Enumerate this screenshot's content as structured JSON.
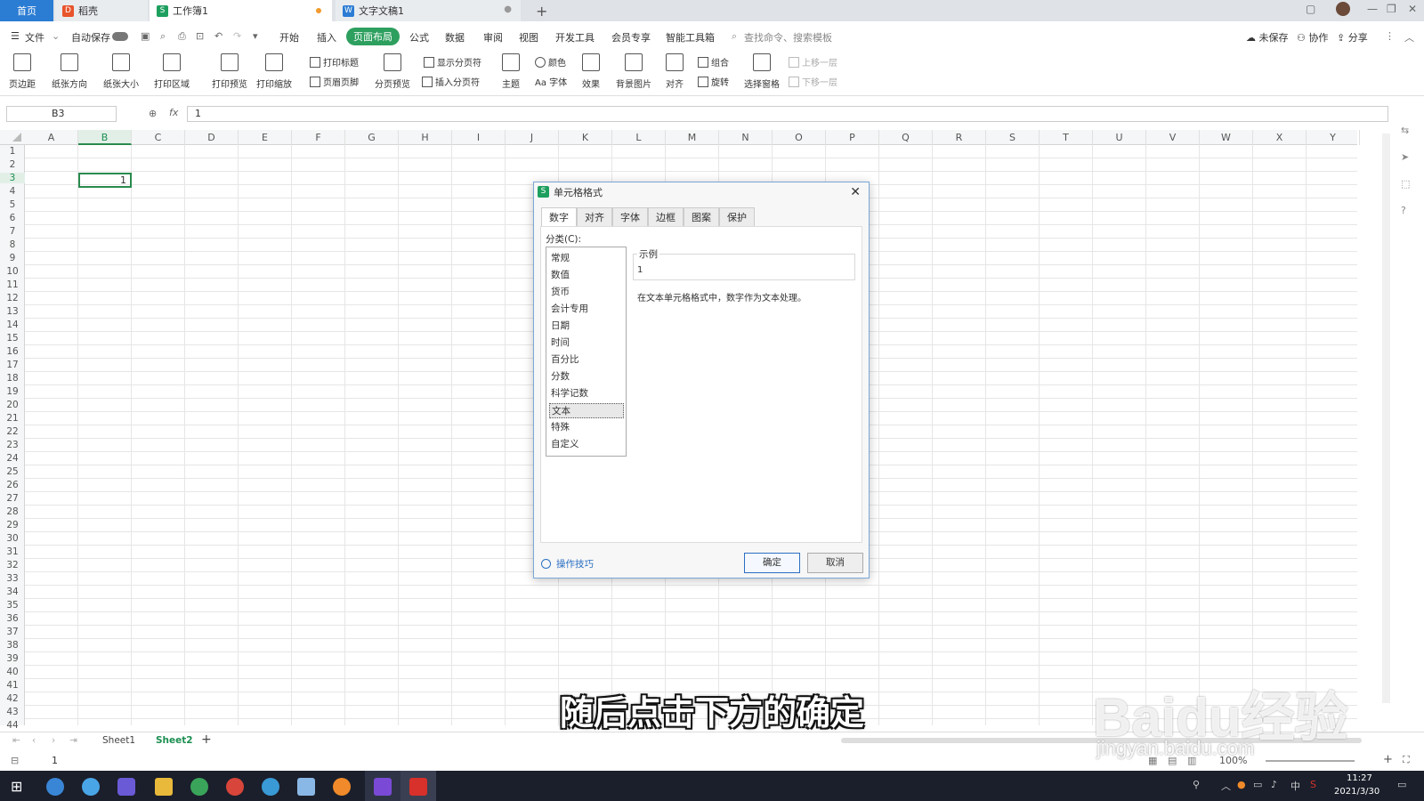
{
  "tabs": {
    "home": "首页",
    "daoke": "稻壳",
    "workbook": "工作簿1",
    "document": "文字文稿1",
    "new_tab": "+"
  },
  "menu": {
    "file": "文件",
    "autosave": "自动保存",
    "items": [
      "开始",
      "插入",
      "页面布局",
      "公式",
      "数据",
      "审阅",
      "视图",
      "开发工具",
      "会员专享",
      "智能工具箱"
    ],
    "active": "页面布局",
    "search_placeholder": "查找命令、搜索模板",
    "unsaved": "未保存",
    "collab": "协作",
    "share": "分享"
  },
  "ribbon": {
    "margins": "页边距",
    "orientation": "纸张方向",
    "size": "纸张大小",
    "print_area": "打印区域",
    "print_preview": "打印预览",
    "print_scale": "打印缩放",
    "print_titles": "打印标题",
    "header_footer": "页眉页脚",
    "page_break_preview": "分页预览",
    "show_breaks": "显示分页符",
    "insert_break": "插入分页符",
    "theme": "主题",
    "color": "颜色",
    "font": "Aa 字体",
    "effects": "效果",
    "background": "背景图片",
    "align": "对齐",
    "group": "组合",
    "rotate": "旋转",
    "select_pane": "选择窗格",
    "bring_forward": "上移一层",
    "send_backward": "下移一层"
  },
  "formula_bar": {
    "name_box": "B3",
    "fx": "fx",
    "value": "1"
  },
  "grid": {
    "columns": [
      "A",
      "B",
      "C",
      "D",
      "E",
      "F",
      "G",
      "H",
      "I",
      "J",
      "K",
      "L",
      "M",
      "N",
      "O",
      "P",
      "Q",
      "R",
      "S",
      "T",
      "U",
      "V",
      "W",
      "X",
      "Y"
    ],
    "rows": [
      "1",
      "2",
      "3",
      "4",
      "5",
      "6",
      "7",
      "8",
      "9",
      "10",
      "11",
      "12",
      "13",
      "14",
      "15",
      "16",
      "17",
      "18",
      "19",
      "20",
      "21",
      "22",
      "23",
      "24",
      "25",
      "26",
      "27",
      "28",
      "29",
      "30",
      "31",
      "32",
      "33",
      "34",
      "35",
      "36",
      "37",
      "38",
      "39",
      "40",
      "41",
      "42",
      "43",
      "44"
    ],
    "selected_cell_value": "1"
  },
  "sheets": {
    "tabs": [
      "Sheet1",
      "Sheet2"
    ],
    "active": "Sheet2",
    "add": "+"
  },
  "status": {
    "value": "1",
    "zoom": "100%"
  },
  "dialog": {
    "title": "单元格格式",
    "tabs": [
      "数字",
      "对齐",
      "字体",
      "边框",
      "图案",
      "保护"
    ],
    "category_label": "分类(C):",
    "categories": [
      "常规",
      "数值",
      "货币",
      "会计专用",
      "日期",
      "时间",
      "百分比",
      "分数",
      "科学记数",
      "文本",
      "特殊",
      "自定义"
    ],
    "selected_category": "文本",
    "sample_label": "示例",
    "sample_value": "1",
    "description": "在文本单元格格式中，数字作为文本处理。",
    "tips": "操作技巧",
    "ok": "确定",
    "cancel": "取消"
  },
  "taskbar": {
    "time": "11:27",
    "date": "2021/3/30",
    "ime": "中"
  },
  "caption": "随后点击下方的确定",
  "watermark": {
    "brand": "Baidu经验",
    "url": "jingyan.baidu.com"
  },
  "colors": {
    "accent_green": "#2d9f5e",
    "home_tab_blue": "#2b7cd3",
    "link_blue": "#2b6fc2"
  }
}
